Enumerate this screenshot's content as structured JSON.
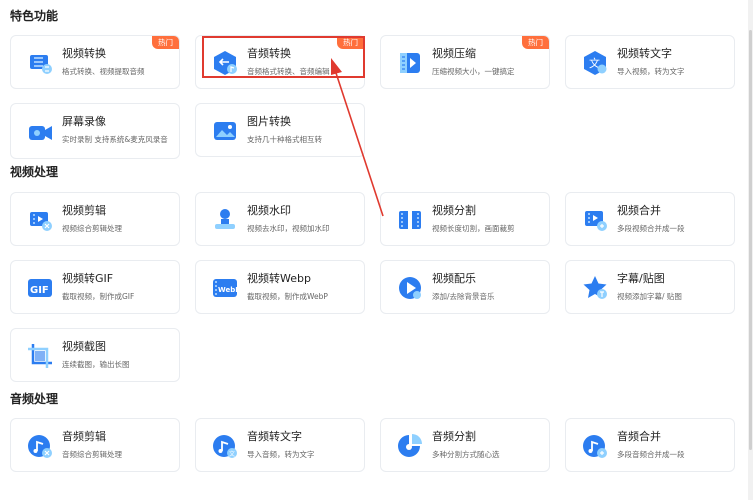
{
  "sections": {
    "featured": "特色功能",
    "video": "视频处理",
    "audio": "音频处理"
  },
  "badge_label": "热门",
  "colors": {
    "accent": "#2c7df0",
    "badge": "#ff6f3c",
    "highlight": "#e03a2f"
  },
  "featured": [
    {
      "title": "视频转换",
      "desc": "格式转换、视频提取音频",
      "icon": "video-convert-icon",
      "badge": true
    },
    {
      "title": "音频转换",
      "desc": "音频格式转换、音频编辑",
      "icon": "audio-convert-icon",
      "badge": true
    },
    {
      "title": "视频压缩",
      "desc": "压缩视频大小，一键搞定",
      "icon": "video-compress-icon",
      "badge": true
    },
    {
      "title": "视频转文字",
      "desc": "导入视频，转为文字",
      "icon": "video-to-text-icon",
      "badge": false
    },
    {
      "title": "屏幕录像",
      "desc": "实时录制 支持系统&麦克风录音",
      "icon": "screen-record-icon",
      "badge": false
    },
    {
      "title": "图片转换",
      "desc": "支持几十种格式相互转",
      "icon": "image-convert-icon",
      "badge": false
    }
  ],
  "video": [
    {
      "title": "视频剪辑",
      "desc": "视频综合剪辑处理",
      "icon": "video-edit-icon"
    },
    {
      "title": "视频水印",
      "desc": "视频去水印，视频加水印",
      "icon": "video-watermark-icon"
    },
    {
      "title": "视频分割",
      "desc": "视频长度切割，画面裁剪",
      "icon": "video-split-icon"
    },
    {
      "title": "视频合并",
      "desc": "多段视频合并成一段",
      "icon": "video-merge-icon"
    },
    {
      "title": "视频转GIF",
      "desc": "截取视频，制作成GIF",
      "icon": "gif-icon",
      "icon_text": "GIF"
    },
    {
      "title": "视频转Webp",
      "desc": "截取视频，制作成WebP",
      "icon": "webp-icon",
      "icon_text": "WebP"
    },
    {
      "title": "视频配乐",
      "desc": "添加/去除背景音乐",
      "icon": "video-music-icon"
    },
    {
      "title": "字幕/贴图",
      "desc": "视频添加字幕/ 贴图",
      "icon": "subtitle-sticker-icon"
    },
    {
      "title": "视频截图",
      "desc": "连续截图，输出长图",
      "icon": "video-screenshot-icon"
    }
  ],
  "audio": [
    {
      "title": "音频剪辑",
      "desc": "音频综合剪辑处理",
      "icon": "audio-edit-icon"
    },
    {
      "title": "音频转文字",
      "desc": "导入音频，转为文字",
      "icon": "audio-to-text-icon"
    },
    {
      "title": "音频分割",
      "desc": "多种分割方式随心选",
      "icon": "audio-split-icon"
    },
    {
      "title": "音频合并",
      "desc": "多段音频合并成一段",
      "icon": "audio-merge-icon"
    }
  ]
}
